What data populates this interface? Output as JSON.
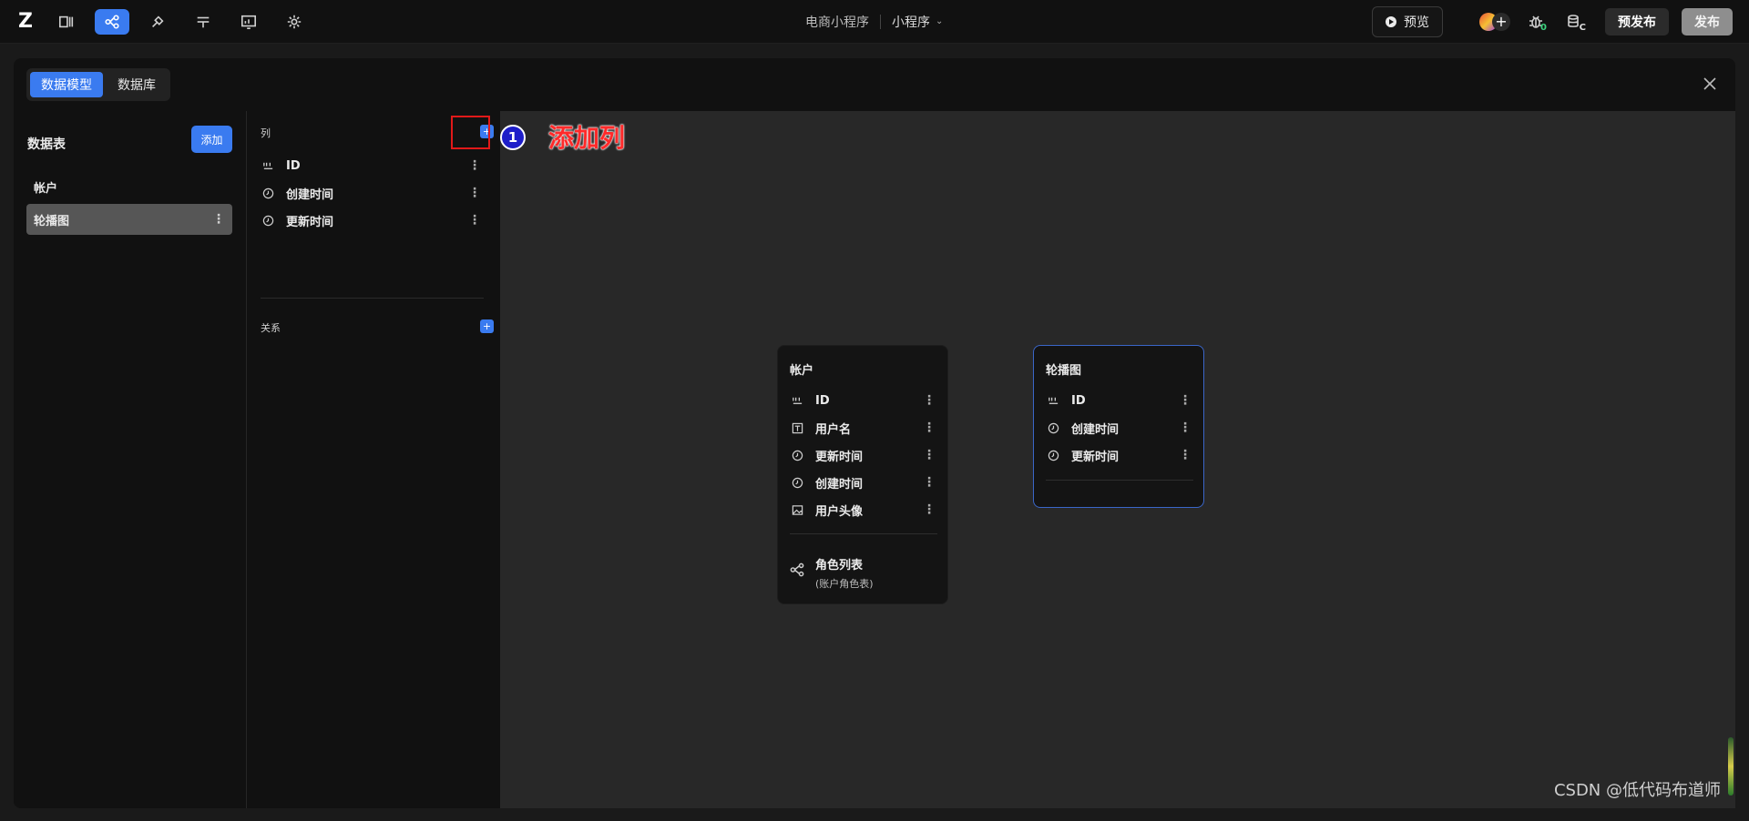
{
  "topbar": {
    "logo": "Z",
    "project_name": "电商小程序",
    "app_type": "小程序",
    "preview_label": "预览",
    "prepublish_label": "预发布",
    "publish_label": "发布",
    "bug_count": "0",
    "db_badge": "C"
  },
  "modal": {
    "tabs": [
      "数据模型",
      "数据库"
    ],
    "left": {
      "title": "数据表",
      "add_label": "添加",
      "tables": [
        {
          "name": "帐户",
          "selected": false
        },
        {
          "name": "轮播图",
          "selected": true
        }
      ]
    },
    "middle": {
      "columns_label": "列",
      "columns": [
        {
          "icon": "id-icon",
          "name": "ID"
        },
        {
          "icon": "clock-icon",
          "name": "创建时间"
        },
        {
          "icon": "clock-icon",
          "name": "更新时间"
        }
      ],
      "relations_label": "关系"
    },
    "annotation": {
      "number": "1",
      "text": "添加列"
    },
    "cards": [
      {
        "title": "帐户",
        "rows": [
          {
            "icon": "id-icon",
            "name": "ID"
          },
          {
            "icon": "text-icon",
            "name": "用户名"
          },
          {
            "icon": "clock-icon",
            "name": "更新时间"
          },
          {
            "icon": "clock-icon",
            "name": "创建时间"
          },
          {
            "icon": "image-icon",
            "name": "用户头像"
          }
        ],
        "relation": {
          "name": "角色列表",
          "sub": "(账户角色表)"
        }
      },
      {
        "title": "轮播图",
        "rows": [
          {
            "icon": "id-icon",
            "name": "ID"
          },
          {
            "icon": "clock-icon",
            "name": "创建时间"
          },
          {
            "icon": "clock-icon",
            "name": "更新时间"
          }
        ]
      }
    ]
  },
  "watermark": "CSDN @低代码布道师",
  "colors": {
    "accent": "#3a7bf0",
    "annotation_red": "#e11919",
    "annotation_blue": "#1e1ec9"
  }
}
